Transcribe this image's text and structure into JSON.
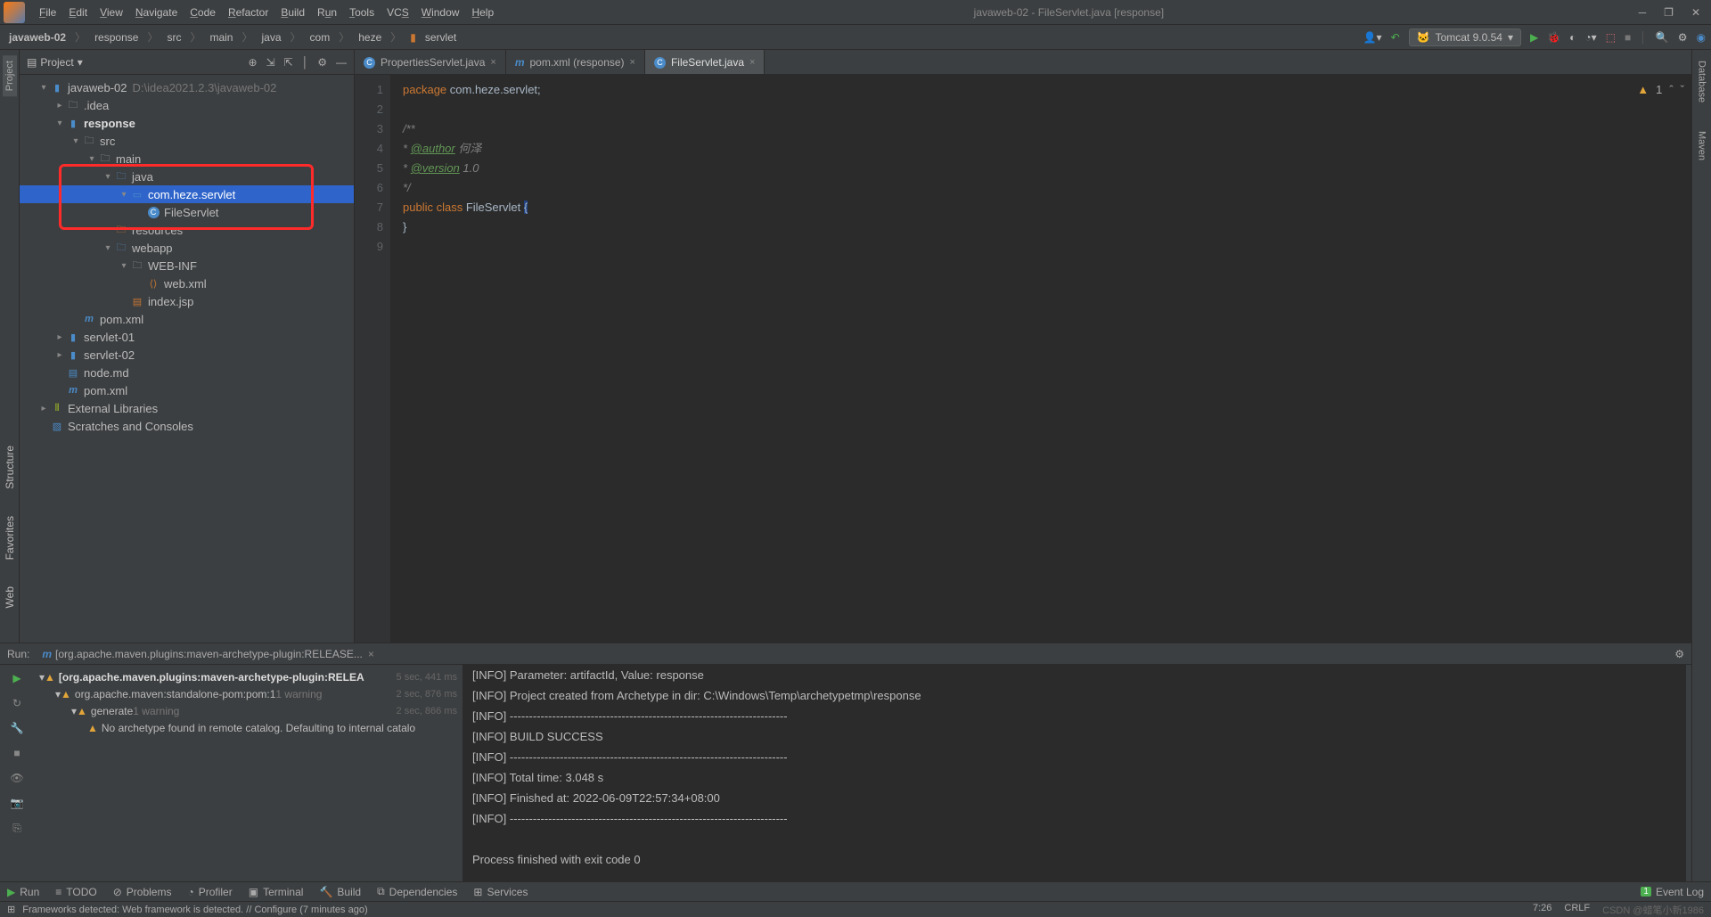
{
  "window": {
    "title": "javaweb-02 - FileServlet.java [response]"
  },
  "menus": [
    "File",
    "Edit",
    "View",
    "Navigate",
    "Code",
    "Refactor",
    "Build",
    "Run",
    "Tools",
    "VCS",
    "Window",
    "Help"
  ],
  "breadcrumbs": [
    "javaweb-02",
    "response",
    "src",
    "main",
    "java",
    "com",
    "heze",
    "servlet"
  ],
  "breadcrumbs_last_icon": "folder",
  "runconfig": {
    "label": "Tomcat 9.0.54"
  },
  "project": {
    "title": "Project",
    "root": {
      "name": "javaweb-02",
      "path": "D:\\idea2021.2.3\\javaweb-02"
    },
    "tree": [
      {
        "depth": 0,
        "arrow": "v",
        "icon": "module",
        "label": "javaweb-02",
        "dim": "D:\\idea2021.2.3\\javaweb-02"
      },
      {
        "depth": 1,
        "arrow": ">",
        "icon": "folder",
        "label": ".idea"
      },
      {
        "depth": 1,
        "arrow": "v",
        "icon": "module",
        "label": "response",
        "bold": true
      },
      {
        "depth": 2,
        "arrow": "v",
        "icon": "folder",
        "label": "src"
      },
      {
        "depth": 3,
        "arrow": "v",
        "icon": "folder",
        "label": "main"
      },
      {
        "depth": 4,
        "arrow": "v",
        "icon": "src-folder",
        "label": "java"
      },
      {
        "depth": 5,
        "arrow": "v",
        "icon": "package",
        "label": "com.heze.servlet",
        "selected": true
      },
      {
        "depth": 6,
        "arrow": "",
        "icon": "class",
        "label": "FileServlet"
      },
      {
        "depth": 4,
        "arrow": "",
        "icon": "res-folder",
        "label": "resources"
      },
      {
        "depth": 4,
        "arrow": "v",
        "icon": "web-folder",
        "label": "webapp"
      },
      {
        "depth": 5,
        "arrow": "v",
        "icon": "folder",
        "label": "WEB-INF"
      },
      {
        "depth": 6,
        "arrow": "",
        "icon": "xml",
        "label": "web.xml"
      },
      {
        "depth": 5,
        "arrow": "",
        "icon": "jsp",
        "label": "index.jsp"
      },
      {
        "depth": 2,
        "arrow": "",
        "icon": "maven",
        "label": "pom.xml"
      },
      {
        "depth": 1,
        "arrow": ">",
        "icon": "module",
        "label": "servlet-01"
      },
      {
        "depth": 1,
        "arrow": ">",
        "icon": "module",
        "label": "servlet-02"
      },
      {
        "depth": 1,
        "arrow": "",
        "icon": "md",
        "label": "node.md"
      },
      {
        "depth": 1,
        "arrow": "",
        "icon": "maven",
        "label": "pom.xml"
      },
      {
        "depth": 0,
        "arrow": ">",
        "icon": "lib",
        "label": "External Libraries"
      },
      {
        "depth": 0,
        "arrow": "",
        "icon": "scratch",
        "label": "Scratches and Consoles"
      }
    ]
  },
  "editor_tabs": [
    {
      "icon": "class",
      "label": "PropertiesServlet.java",
      "active": false
    },
    {
      "icon": "maven",
      "label": "pom.xml (response)",
      "active": false
    },
    {
      "icon": "class",
      "label": "FileServlet.java",
      "active": true
    }
  ],
  "editor_status": {
    "warnings": "1"
  },
  "code": {
    "lines": [
      1,
      2,
      3,
      4,
      5,
      6,
      7,
      8,
      9
    ],
    "l1_pkg": "package",
    "l1_rest": " com.heze.servlet;",
    "l3": "/**",
    "l4_pre": " * ",
    "l4_tag": "@author",
    "l4_rest": " 何泽",
    "l5_pre": " * ",
    "l5_tag": "@version",
    "l5_rest": " 1.0",
    "l6": " */",
    "l7_pub": "public ",
    "l7_cls": "class ",
    "l7_name": "FileServlet ",
    "l7_brace": "{",
    "l8": " }"
  },
  "run": {
    "label": "Run:",
    "tab": "[org.apache.maven.plugins:maven-archetype-plugin:RELEASE...",
    "tree": [
      {
        "depth": 0,
        "arrow": "v",
        "warn": true,
        "label": "[org.apache.maven.plugins:maven-archetype-plugin:RELEA",
        "time": "5 sec, 441 ms",
        "bold": true
      },
      {
        "depth": 1,
        "arrow": "v",
        "warn": true,
        "label": "org.apache.maven:standalone-pom:pom:1",
        "note": "1 warning",
        "time": "2 sec, 876 ms"
      },
      {
        "depth": 2,
        "arrow": "v",
        "warn": true,
        "label": "generate",
        "note": "1 warning",
        "time": "2 sec, 866 ms"
      },
      {
        "depth": 3,
        "arrow": "",
        "warn": true,
        "label": "No archetype found in remote catalog. Defaulting to internal catalo"
      }
    ],
    "console": [
      "[INFO] Parameter: artifactId, Value: response",
      "[INFO] Project created from Archetype in dir: C:\\Windows\\Temp\\archetypetmp\\response",
      "[INFO] ------------------------------------------------------------------------",
      "[INFO] BUILD SUCCESS",
      "[INFO] ------------------------------------------------------------------------",
      "[INFO] Total time:  3.048 s",
      "[INFO] Finished at: 2022-06-09T22:57:34+08:00",
      "[INFO] ------------------------------------------------------------------------",
      "",
      "Process finished with exit code 0"
    ]
  },
  "bottombar": {
    "run": "Run",
    "todo": "TODO",
    "problems": "Problems",
    "profiler": "Profiler",
    "terminal": "Terminal",
    "build": "Build",
    "dependencies": "Dependencies",
    "services": "Services",
    "eventlog": "Event Log"
  },
  "statusbar": {
    "msg": "Frameworks detected: Web framework is detected. // Configure (7 minutes ago)",
    "pos": "7:26",
    "enc": "CRLF",
    "watermark": "CSDN @蜡笔小新1986"
  },
  "left_tabs": [
    "Project",
    "Structure",
    "Favorites",
    "Web"
  ],
  "right_tabs": [
    "Database",
    "Maven"
  ]
}
